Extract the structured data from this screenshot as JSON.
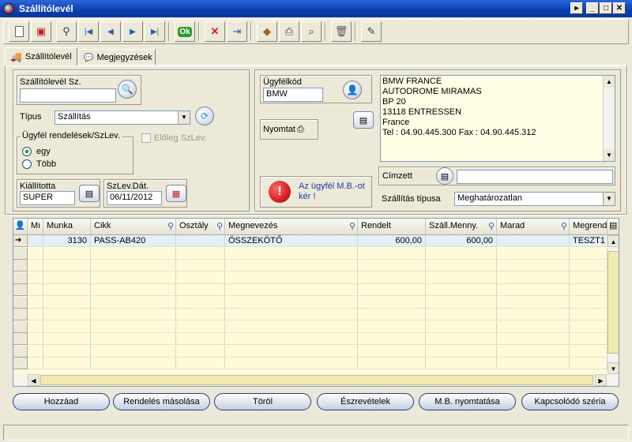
{
  "window": {
    "title": "Szállítólevél"
  },
  "toolbar": {
    "buttons": [
      {
        "name": "new-doc-icon"
      },
      {
        "name": "save-icon"
      },
      {
        "name": "search-icon"
      },
      {
        "name": "first-record-icon"
      },
      {
        "name": "prev-record-icon"
      },
      {
        "name": "next-record-icon"
      },
      {
        "name": "last-record-icon"
      },
      {
        "name": "ok-icon",
        "label": "Ok"
      },
      {
        "name": "delete-icon"
      },
      {
        "name": "exit-icon"
      },
      {
        "name": "package-icon"
      },
      {
        "name": "print-icon"
      },
      {
        "name": "preview-icon"
      },
      {
        "name": "trash-icon"
      },
      {
        "name": "notes-icon"
      }
    ]
  },
  "tabs": [
    {
      "label": "Szállítólevél",
      "active": true
    },
    {
      "label": "Megjegyzések",
      "active": false
    }
  ],
  "form": {
    "delivery_note_no_label": "Szállítólevél Sz.",
    "delivery_note_no": "",
    "type_label": "Típus",
    "type_value": "Szállítás",
    "orders_group_label": "Ügyfél rendelések/SzLev.",
    "radio_single": "egy",
    "radio_multi": "Több",
    "advance_label": "Előleg SzLev.",
    "issued_by_label": "Kiállította",
    "issued_by": "SUPER",
    "date_label": "SzLev.Dát.",
    "date": "06/11/2012",
    "customer_code_label": "Ügyfélkód",
    "customer_code": "BMW",
    "print_label": "Nyomtat",
    "alert_text": "Az ügyfél M.B.-ot kér !",
    "address_lines": [
      "BMW FRANCE",
      "AUTODROME MIRAMAS",
      "BP 20",
      "13118 ENTRESSEN",
      "France",
      "Tel : 04.90.445.300 Fax : 04.90.445.312"
    ],
    "recipient_label": "Címzett",
    "recipient": "",
    "shipping_type_label": "Szállítás típusa",
    "shipping_type": "Meghatározatlan"
  },
  "grid": {
    "columns": [
      "Mı",
      "Munka",
      "Cikk",
      "Osztály",
      "Megnevezés",
      "Rendelt",
      "Száll.Menny.",
      "Marad",
      "Megrend"
    ],
    "rows": [
      {
        "mi": "",
        "munka": "3130",
        "cikk": "PASS-AB420",
        "osztaly": "",
        "megnevezes": "ÖSSZEKÖTŐ",
        "rendelt": "600,00",
        "szall": "600,00",
        "marad": "",
        "megrend": "TESZT1"
      }
    ]
  },
  "buttons": {
    "add": "Hozzáad",
    "copy_order": "Rendelés másolása",
    "delete": "Töröl",
    "remarks": "Észrevételek",
    "print_mb": "M.B. nyomtatása",
    "related_series": "Kapcsolódó széria"
  },
  "colors": {
    "title_bar": "#0a3fb0",
    "row_highlight": "#e3eef8",
    "grid_fill": "#fffbd9",
    "alert_red": "#d42020"
  }
}
